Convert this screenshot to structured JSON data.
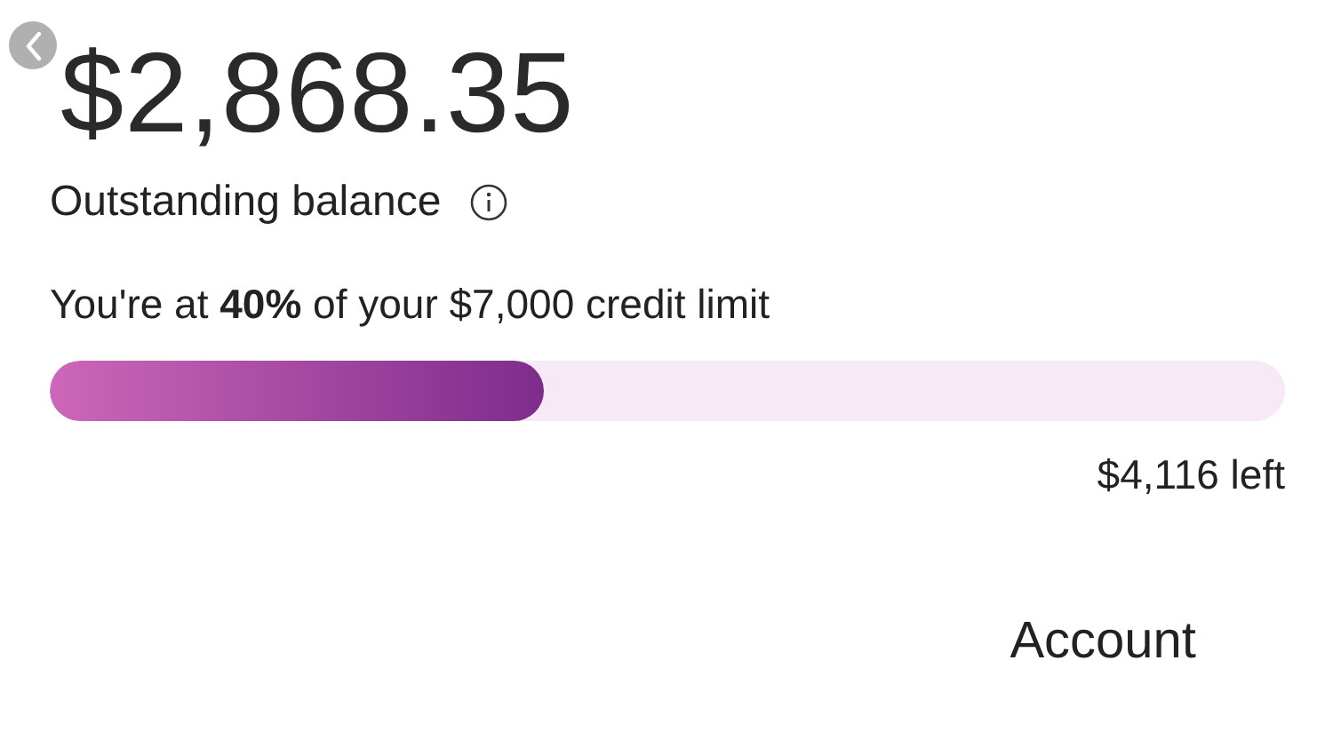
{
  "balance": {
    "amount": "$2,868.35",
    "label": "Outstanding balance"
  },
  "credit": {
    "summary": "You're at **40%** of your $7,000 credit limit",
    "level": 0.4,
    "remaining": "$4,116 left"
  },
  "nav": {
    "label": "Account"
  }
}
